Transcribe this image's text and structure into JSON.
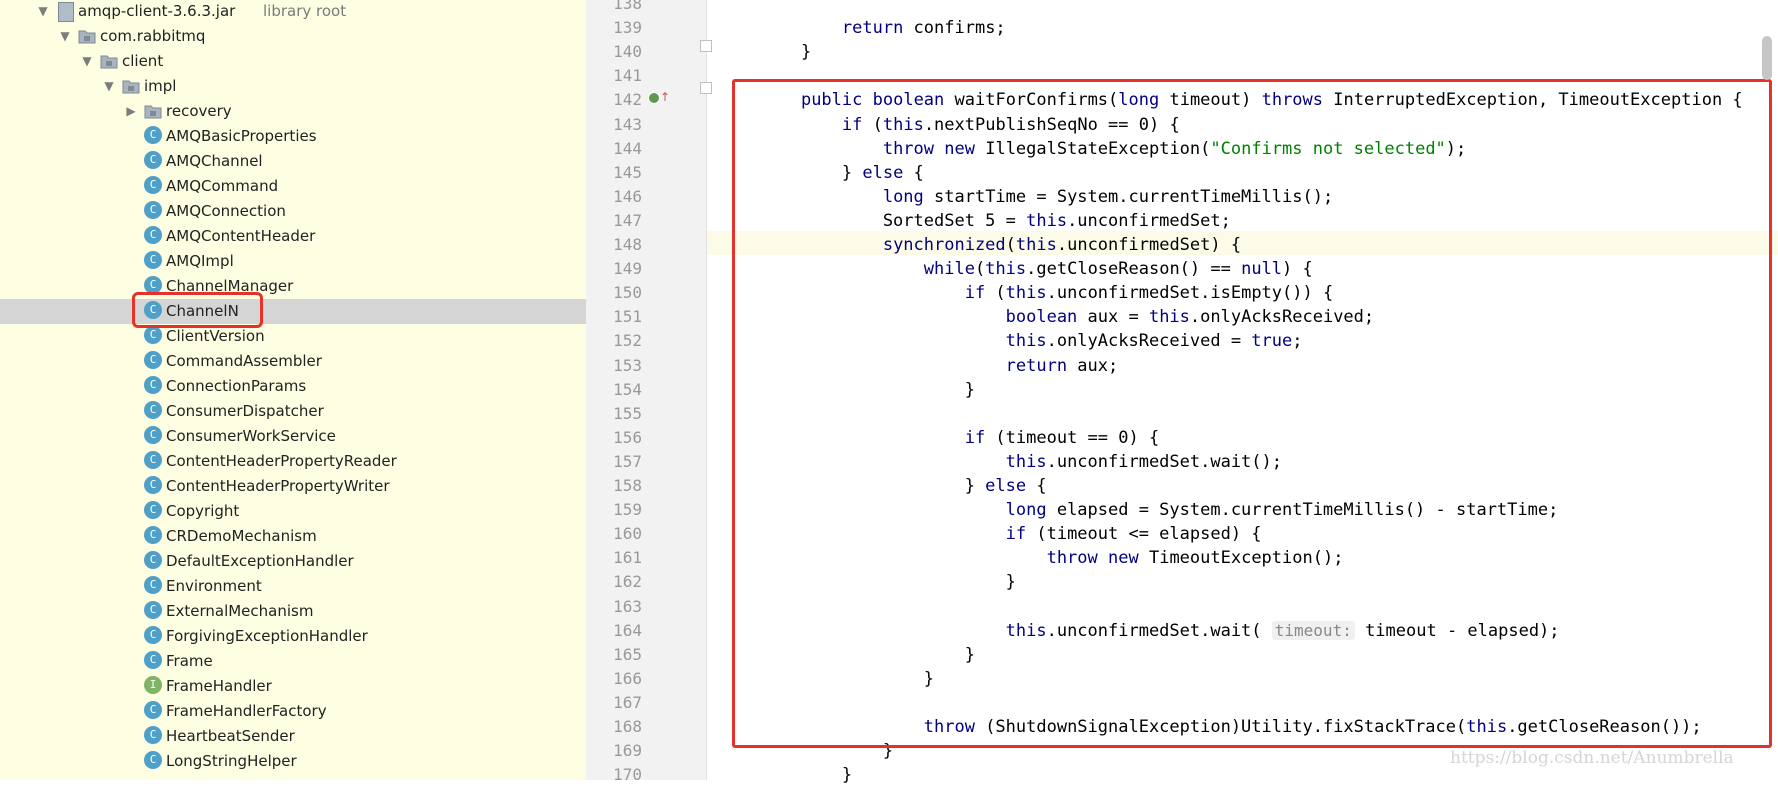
{
  "sidebar": {
    "jar": {
      "name": "amqp-client-3.6.3.jar",
      "note": "library root"
    },
    "packages": [
      "com.rabbitmq",
      "client",
      "impl"
    ],
    "folders": [
      "recovery"
    ],
    "classes": [
      {
        "name": "AMQBasicProperties",
        "kind": "class"
      },
      {
        "name": "AMQChannel",
        "kind": "class"
      },
      {
        "name": "AMQCommand",
        "kind": "class"
      },
      {
        "name": "AMQConnection",
        "kind": "class"
      },
      {
        "name": "AMQContentHeader",
        "kind": "class"
      },
      {
        "name": "AMQImpl",
        "kind": "class"
      },
      {
        "name": "ChannelManager",
        "kind": "class"
      },
      {
        "name": "ChannelN",
        "kind": "class"
      },
      {
        "name": "ClientVersion",
        "kind": "class"
      },
      {
        "name": "CommandAssembler",
        "kind": "class"
      },
      {
        "name": "ConnectionParams",
        "kind": "class"
      },
      {
        "name": "ConsumerDispatcher",
        "kind": "class"
      },
      {
        "name": "ConsumerWorkService",
        "kind": "class"
      },
      {
        "name": "ContentHeaderPropertyReader",
        "kind": "class"
      },
      {
        "name": "ContentHeaderPropertyWriter",
        "kind": "class"
      },
      {
        "name": "Copyright",
        "kind": "class"
      },
      {
        "name": "CRDemoMechanism",
        "kind": "class"
      },
      {
        "name": "DefaultExceptionHandler",
        "kind": "class"
      },
      {
        "name": "Environment",
        "kind": "class"
      },
      {
        "name": "ExternalMechanism",
        "kind": "class"
      },
      {
        "name": "ForgivingExceptionHandler",
        "kind": "class"
      },
      {
        "name": "Frame",
        "kind": "class"
      },
      {
        "name": "FrameHandler",
        "kind": "interface"
      },
      {
        "name": "FrameHandlerFactory",
        "kind": "class"
      },
      {
        "name": "HeartbeatSender",
        "kind": "class"
      },
      {
        "name": "LongStringHelper",
        "kind": "class"
      }
    ],
    "selected": "ChannelN"
  },
  "editor": {
    "first_line": 138,
    "current_line": 148,
    "lines": [
      "",
      "        return confirms;",
      "    }",
      "",
      "    public boolean waitForConfirms(long timeout) throws InterruptedException, TimeoutException {",
      "        if (this.nextPublishSeqNo == 0L) {",
      "            throw new IllegalStateException(\"Confirms not selected\");",
      "        } else {",
      "            long startTime = System.currentTimeMillis();",
      "            SortedSet var5 = this.unconfirmedSet;",
      "            synchronized(this.unconfirmedSet) {",
      "                while(this.getCloseReason() == null) {",
      "                    if (this.unconfirmedSet.isEmpty()) {",
      "                        boolean aux = this.onlyAcksReceived;",
      "                        this.onlyAcksReceived = true;",
      "                        return aux;",
      "                    }",
      "",
      "                    if (timeout == 0L) {",
      "                        this.unconfirmedSet.wait();",
      "                    } else {",
      "                        long elapsed = System.currentTimeMillis() - startTime;",
      "                        if (timeout <= elapsed) {",
      "                            throw new TimeoutException();",
      "                        }",
      "",
      "                        this.unconfirmedSet.wait( timeout: timeout - elapsed);",
      "                    }",
      "                }",
      "",
      "                throw (ShutdownSignalException)Utility.fixStackTrace(this.getCloseReason());",
      "            }",
      "        }"
    ]
  },
  "watermark": "https://blog.csdn.net/Anumbrella"
}
